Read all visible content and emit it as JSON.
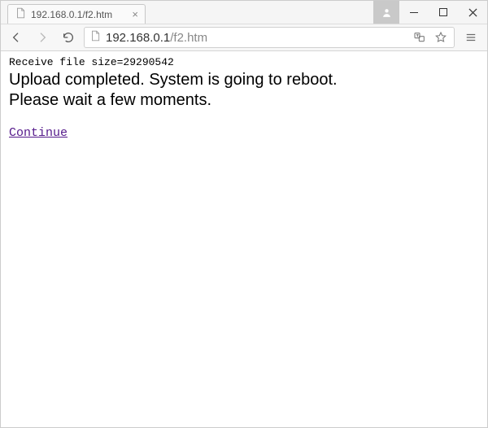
{
  "window": {
    "user_button": "user",
    "minimize": "minimize",
    "maximize": "maximize",
    "close": "close"
  },
  "tab": {
    "title": "192.168.0.1/f2.htm",
    "close_label": "×"
  },
  "toolbar": {
    "back": "back",
    "forward": "forward",
    "reload": "reload",
    "url_host": "192.168.0.1",
    "url_path": "/f2.htm",
    "translate": "translate",
    "bookmark": "bookmark",
    "menu": "menu"
  },
  "page": {
    "receive_line": "Receive file size=29290542",
    "status_line1": "Upload completed.  System is going to reboot.",
    "status_line2": "Please wait a few moments.",
    "continue_label": "Continue"
  }
}
